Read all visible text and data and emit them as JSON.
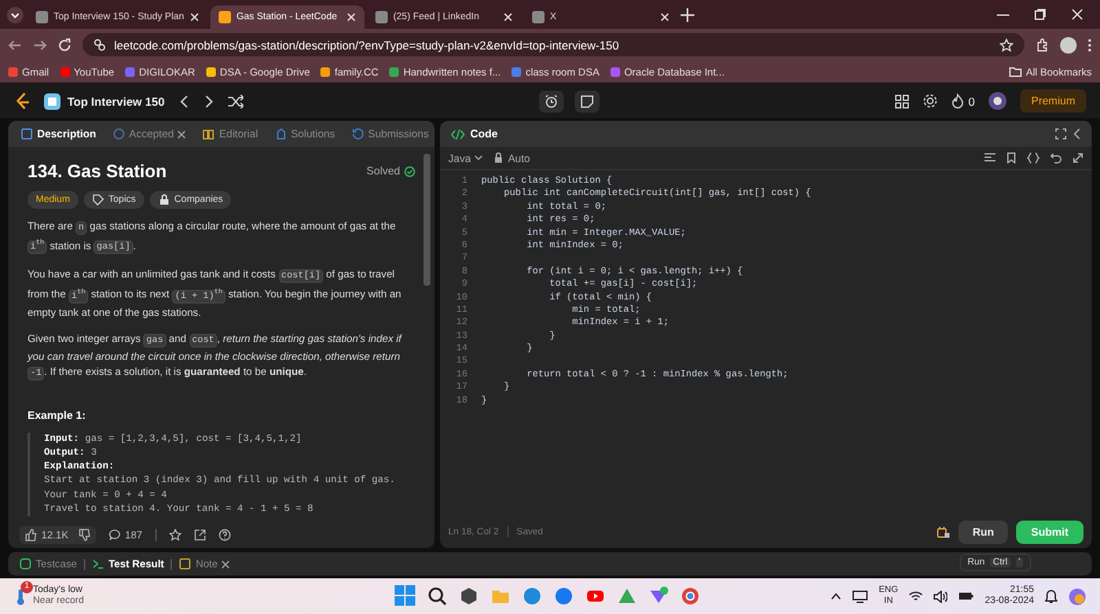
{
  "browser": {
    "tabs": [
      {
        "title": "Top Interview 150 - Study Plan",
        "selected": false
      },
      {
        "title": "Gas Station - LeetCode",
        "selected": true
      },
      {
        "title": "(25) Feed | LinkedIn",
        "selected": false
      },
      {
        "title": "X",
        "selected": false
      }
    ],
    "address": "leetcode.com/problems/gas-station/description/?envType=study-plan-v2&envId=top-interview-150",
    "bookmarks": [
      {
        "label": "Gmail",
        "color": "#ea4335"
      },
      {
        "label": "YouTube",
        "color": "#ff0000"
      },
      {
        "label": "DIGILOKAR",
        "color": "#7b61ff"
      },
      {
        "label": "DSA - Google Drive",
        "color": "#fbbc04"
      },
      {
        "label": "family.CC",
        "color": "#f59e0b"
      },
      {
        "label": "Handwritten notes f...",
        "color": "#34a853"
      },
      {
        "label": "class room DSA",
        "color": "#4a7ee8"
      },
      {
        "label": "Oracle Database Int...",
        "color": "#a855f7"
      }
    ],
    "all_bookmarks": "All Bookmarks"
  },
  "nav": {
    "study_plan": "Top Interview 150",
    "streak": "0",
    "premium": "Premium"
  },
  "description": {
    "tabs": [
      {
        "label": "Description",
        "selected": true,
        "closable": false
      },
      {
        "label": "Accepted",
        "selected": false,
        "closable": true
      },
      {
        "label": "Editorial",
        "selected": false,
        "closable": false
      },
      {
        "label": "Solutions",
        "selected": false,
        "closable": false
      },
      {
        "label": "Submissions",
        "selected": false,
        "closable": false
      }
    ],
    "title": "134. Gas Station",
    "status": "Solved",
    "tags": [
      {
        "kind": "difficulty",
        "label": "Medium"
      },
      {
        "kind": "topics",
        "label": "Topics"
      },
      {
        "kind": "companies",
        "label": "Companies"
      }
    ],
    "paragraphs": [
      [
        {
          "kind": "text",
          "text": "There are "
        },
        {
          "kind": "code",
          "text": "n"
        },
        {
          "kind": "text",
          "text": " gas stations along a circular route, where the amount of gas at the "
        },
        {
          "kind": "code",
          "text": "i$^{th}$"
        },
        {
          "kind": "text",
          "text": " station is "
        },
        {
          "kind": "code",
          "text": "gas[i]"
        },
        {
          "kind": "text",
          "text": "."
        }
      ],
      [
        {
          "kind": "text",
          "text": "You have a car with an unlimited gas tank and it costs "
        },
        {
          "kind": "code",
          "text": "cost[i]"
        },
        {
          "kind": "text",
          "text": " of gas to travel from the "
        },
        {
          "kind": "code",
          "text": "i$^{th}$"
        },
        {
          "kind": "text",
          "text": " station to its next "
        },
        {
          "kind": "code",
          "text": "(i + 1)$^{th}$"
        },
        {
          "kind": "text",
          "text": " station. You begin the journey with an empty tank at one of the gas stations."
        }
      ],
      [
        {
          "kind": "text",
          "text": "Given two integer arrays "
        },
        {
          "kind": "code",
          "text": "gas"
        },
        {
          "kind": "text",
          "text": " and "
        },
        {
          "kind": "code",
          "text": "cost"
        },
        {
          "kind": "text",
          "text": ", *return the starting gas station's index if you can travel around the circuit once in the clockwise direction, otherwise return* "
        },
        {
          "kind": "code",
          "text": "-1"
        },
        {
          "kind": "text",
          "text": ". If there exists a solution, it is **guaranteed** to be **unique**."
        }
      ]
    ],
    "example": {
      "title": "Example 1:",
      "lines": [
        {
          "label": "Input:",
          "text": "gas = [1,2,3,4,5], cost = [3,4,5,1,2]"
        },
        {
          "label": "Output:",
          "text": "3"
        },
        {
          "label": "Explanation:"
        },
        {
          "text": "Start at station 3 (index 3) and fill up with 4 unit of gas."
        },
        {
          "text": "Your tank = 0 + 4 = 4"
        },
        {
          "text": "Travel to station 4. Your tank = 4 - 1 + 5 = 8"
        }
      ]
    },
    "likes": "12.1K",
    "comments": "187"
  },
  "code": {
    "title": "Code",
    "language": "Java",
    "mode": "Auto",
    "lines": [
      {
        "n": "1",
        "text": "public class Solution {"
      },
      {
        "n": "2",
        "text": "    public int canCompleteCircuit(int[] gas, int[] cost) {"
      },
      {
        "n": "3",
        "text": "        int total = 0;"
      },
      {
        "n": "4",
        "text": "        int res = 0;"
      },
      {
        "n": "5",
        "text": "        int min = Integer.MAX_VALUE;"
      },
      {
        "n": "6",
        "text": "        int minIndex = 0;"
      },
      {
        "n": "7"
      },
      {
        "n": "8",
        "text": "        for (int i = 0; i < gas.length; i++) {"
      },
      {
        "n": "9",
        "text": "            total += gas[i] - cost[i];"
      },
      {
        "n": "10",
        "text": "            if (total < min) {"
      },
      {
        "n": "11",
        "text": "                min = total;"
      },
      {
        "n": "12",
        "text": "                minIndex = i + 1;"
      },
      {
        "n": "13",
        "text": "            }"
      },
      {
        "n": "14",
        "text": "        }"
      },
      {
        "n": "15"
      },
      {
        "n": "16",
        "text": "        return total < 0 ? -1 : minIndex % gas.length;"
      },
      {
        "n": "17",
        "text": "    }"
      },
      {
        "n": "18",
        "text": "}"
      }
    ],
    "position": "Ln 18, Col 2",
    "saved": "Saved",
    "run": "Run",
    "submit": "Submit",
    "tooltip": {
      "label": "Run",
      "keys": [
        "Ctrl",
        "'"
      ]
    }
  },
  "bottom_tabs": [
    {
      "label": "Testcase",
      "selected": false,
      "closable": false
    },
    {
      "label": "Test Result",
      "selected": true,
      "closable": false
    },
    {
      "label": "Note",
      "selected": false,
      "closable": true
    }
  ],
  "taskbar": {
    "weather_title": "Today's low",
    "weather_subtitle": "Near record",
    "weather_badge": "1",
    "language": "ENG",
    "region": "IN",
    "time": "21:55",
    "date": "23-08-2024"
  }
}
